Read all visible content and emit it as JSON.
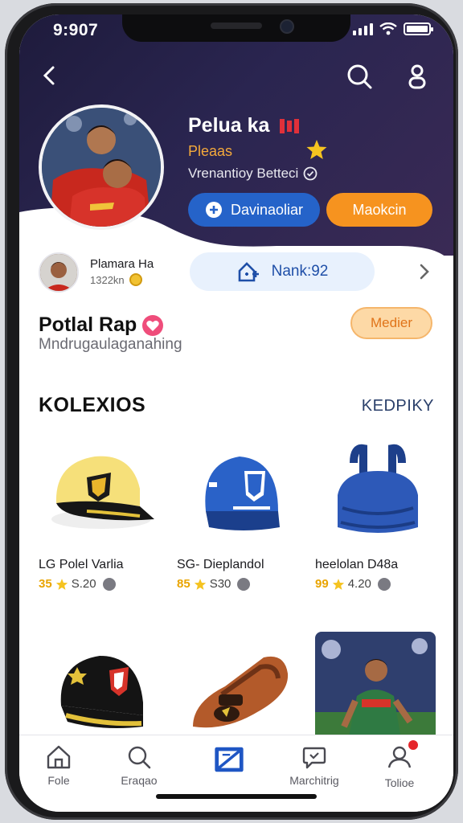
{
  "status": {
    "time": "9:907"
  },
  "profile": {
    "name": "Pelua ka",
    "role": "Pleaas",
    "subtitle": "Vrenantioy Betteci",
    "follow_label": "Davinaoliar",
    "message_label": "Maokcin"
  },
  "friend": {
    "name": "Plamara Ha",
    "meta": "1322kn",
    "rank_label": "Nank:92"
  },
  "section": {
    "title": "Potlal Rap",
    "subtitle": "Mndrugaulaganahing",
    "more_label": "Medier"
  },
  "collections": {
    "title": "KOLEXIOS",
    "link": "KEDPIKY",
    "items": [
      {
        "name": "LG Polel Varlia",
        "rating": "35",
        "price": "S.20",
        "icon": "cap-yellow"
      },
      {
        "name": "SG- Dieplandol",
        "rating": "85",
        "price": "S30",
        "icon": "cap-blue"
      },
      {
        "name": "heelolan D48a",
        "rating": "99",
        "price": "4.20",
        "icon": "bag-blue"
      },
      {
        "name": "",
        "rating": "",
        "price": "",
        "icon": "cap-black"
      },
      {
        "name": "",
        "rating": "",
        "price": "",
        "icon": "shoe-brown"
      },
      {
        "name": "",
        "rating": "",
        "price": "",
        "icon": "player-photo"
      }
    ]
  },
  "tabs": [
    {
      "label": "Fole",
      "icon": "home-icon"
    },
    {
      "label": "Eraqao",
      "icon": "search-icon"
    },
    {
      "label": "",
      "icon": "ticket-icon"
    },
    {
      "label": "Marchitrig",
      "icon": "chat-icon"
    },
    {
      "label": "Tolioe",
      "icon": "user-icon"
    }
  ],
  "colors": {
    "hero": "#221d45",
    "primary_blue": "#2563c9",
    "accent_orange": "#f6931f",
    "rating_gold": "#e9a400"
  }
}
